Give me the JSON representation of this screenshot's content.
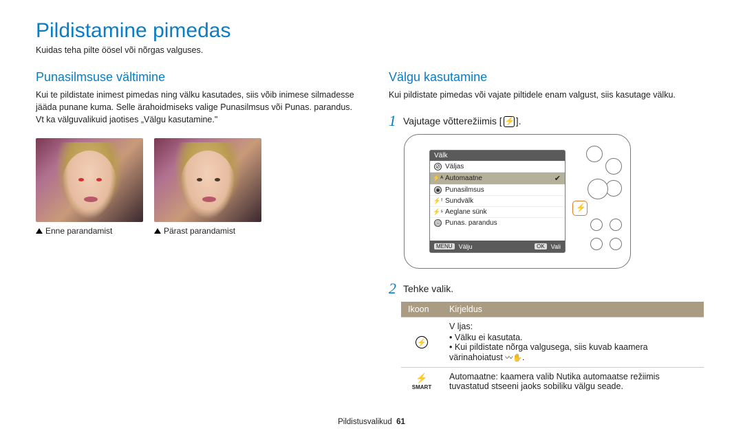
{
  "page": {
    "title": "Pildistamine pimedas",
    "subtitle": "Kuidas teha pilte öösel või nõrgas valguses."
  },
  "left": {
    "heading": "Punasilmsuse vältimine",
    "body": "Kui te pildistate inimest pimedas ning välku kasutades, siis võib inimese silmadesse jääda punane kuma. Selle ärahoidmiseks valige Punasilmsus või Punas. parandus. Vt ka välguvalikuid jaotises „Välgu kasutamine.\"",
    "cap_before": "Enne parandamist",
    "cap_after": "Pärast parandamist"
  },
  "right": {
    "heading": "Välgu kasutamine",
    "body": "Kui pildistate pimedas või vajate piltidele enam valgust, siis kasutage välku.",
    "step1": "Vajutage võtterežiimis [",
    "step1_suffix": "].",
    "step2": "Tehke valik.",
    "menu_header": "Välk",
    "menu_items": [
      "Väljas",
      "Automaatne",
      "Punasilmsus",
      "Sundvälk",
      "Aeglane sünk",
      "Punas. parandus"
    ],
    "menu_exit_label": "MENU",
    "menu_exit": "Välju",
    "menu_ok_label": "OK",
    "menu_ok": "Vali",
    "table": {
      "h_icon": "Ikoon",
      "h_desc": "Kirjeldus",
      "r1_title": "V ljas:",
      "r1_b1": "Välku ei kasutata.",
      "r1_b2a": "Kui pildistate nõrga valgusega, siis kuvab kaamera värinahoiatust ",
      "r1_b2b": ".",
      "r2": "Automaatne: kaamera valib Nutika automaatse režiimis tuvastatud stseeni jaoks sobiliku välgu seade."
    }
  },
  "footer": {
    "section": "Pildistusvalikud",
    "page": "61"
  }
}
